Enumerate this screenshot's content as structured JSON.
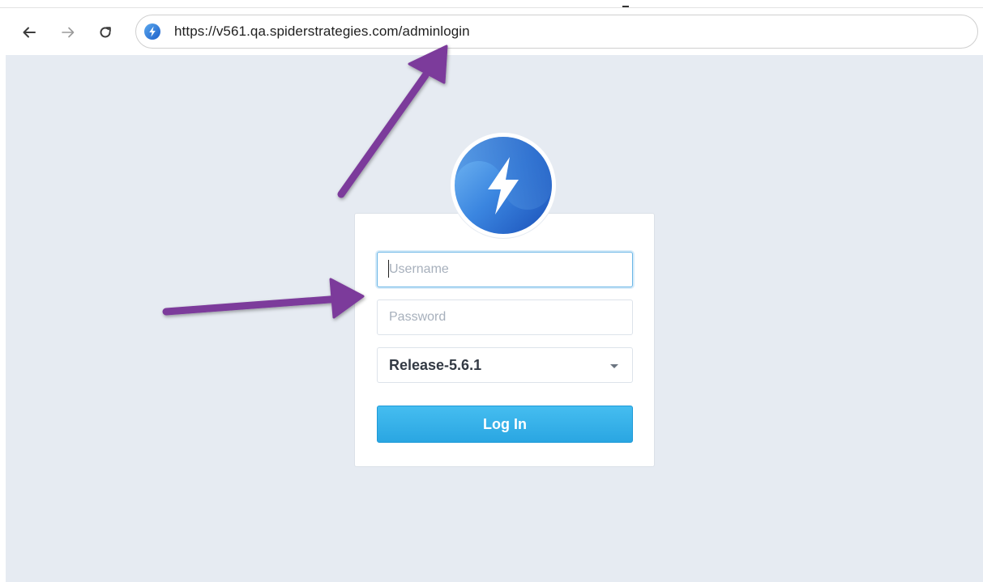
{
  "browser": {
    "url": "https://v561.qa.spiderstrategies.com/adminlogin",
    "icons": {
      "back": "arrow-left-icon",
      "forward": "arrow-right-icon",
      "reload": "reload-icon",
      "site": "site-bolt-icon"
    }
  },
  "login": {
    "username_placeholder": "Username",
    "password_placeholder": "Password",
    "release_selected": "Release-5.6.1",
    "login_label": "Log In"
  },
  "colors": {
    "page_background": "#e6ebf2",
    "button": "#2aa6e2",
    "annotation_arrow": "#7b3a9b",
    "logo_blue": "#2b74d8"
  }
}
